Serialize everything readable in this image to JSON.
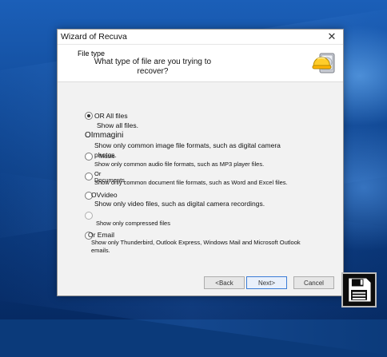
{
  "window": {
    "title": "Wizard of Recuva",
    "close_glyph": "✕"
  },
  "header": {
    "step_title": "File type",
    "question": "What type of file are you trying to recover?"
  },
  "options": [
    {
      "label": "OR All files",
      "description": "Show all files.",
      "selected": true
    },
    {
      "label": "OImmagini",
      "description": "Show only common image file formats, such as digital camera photos.",
      "selected": false
    },
    {
      "label": "Music",
      "description": "Show only common audio file formats, such as MP3 player files.",
      "selected": false
    },
    {
      "label": "Or Documents",
      "description": "Show only common document file formats, such as Word and Excel files.",
      "selected": false
    },
    {
      "label": "OVvideo",
      "description": "Show only video files, such as digital camera recordings.",
      "selected": false
    },
    {
      "label": "",
      "description": "Show only compressed files",
      "selected": false
    },
    {
      "label": "Or Email",
      "description": "Show only Thunderbird, Outlook Express, Windows Mail and Microsoft Outlook emails.",
      "selected": false
    }
  ],
  "buttons": {
    "back": "<Back",
    "next": "Next>",
    "cancel": "Cancel"
  },
  "icons": {
    "app": "recuva-hardhat-drive-icon",
    "taskbar": "floppy-disk-icon"
  },
  "colors": {
    "desktop_blue": "#0c3f87",
    "accent": "#3b7cd6"
  }
}
